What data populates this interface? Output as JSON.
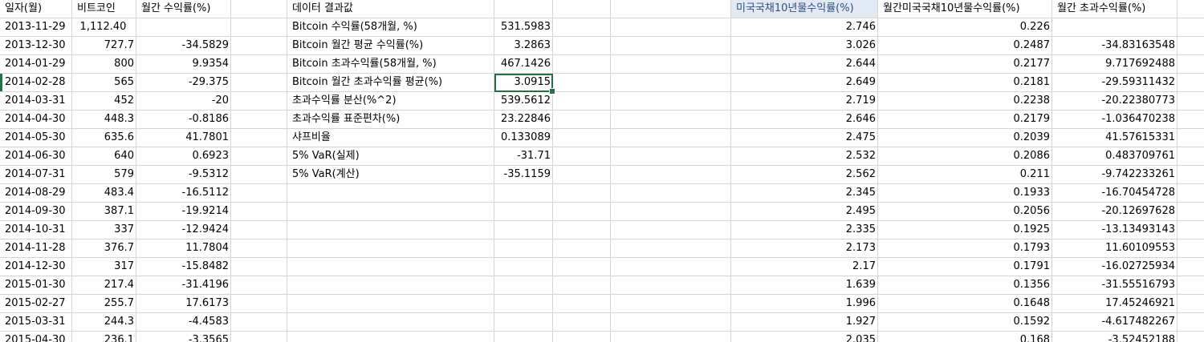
{
  "headers": {
    "date": "일자(월)",
    "btc": "비트코인",
    "btc_ret": "월간 수익률(%)",
    "results": "데이터 결과값",
    "tsy": "미국국채10년물수익률(%)",
    "tsy_month": "월간미국국채10년물수익률(%)",
    "excess": "월간 초과수익률(%)"
  },
  "rows": [
    {
      "date": "2013-11-29",
      "btc": "1,112.40",
      "ret": "",
      "label": "Bitcoin 수익률(58개월, %)",
      "val": "531.5983",
      "tsy": "2.746",
      "tsym": "0.226",
      "ex": ""
    },
    {
      "date": "2013-12-30",
      "btc": "727.7",
      "ret": "-34.5829",
      "label": "Bitcoin 월간 평균 수익률(%)",
      "val": "3.2863",
      "tsy": "3.026",
      "tsym": "0.2487",
      "ex": "-34.83163548"
    },
    {
      "date": "2014-01-29",
      "btc": "800",
      "ret": "9.9354",
      "label": "Bitcoin 초과수익률(58개월, %)",
      "val": "467.1426",
      "tsy": "2.644",
      "tsym": "0.2177",
      "ex": "9.717692488"
    },
    {
      "date": "2014-02-28",
      "btc": "565",
      "ret": "-29.375",
      "label": "Bitcoin 월간 초과수익률 평균(%)",
      "val": "3.0915",
      "tsy": "2.649",
      "tsym": "0.2181",
      "ex": "-29.59311432"
    },
    {
      "date": "2014-03-31",
      "btc": "452",
      "ret": "-20",
      "label": "초과수익률 분산(%^2)",
      "val": "539.5612",
      "tsy": "2.719",
      "tsym": "0.2238",
      "ex": "-20.22380773"
    },
    {
      "date": "2014-04-30",
      "btc": "448.3",
      "ret": "-0.8186",
      "label": "초과수익률 표준편차(%)",
      "val": "23.22846",
      "tsy": "2.646",
      "tsym": "0.2179",
      "ex": "-1.036470238"
    },
    {
      "date": "2014-05-30",
      "btc": "635.6",
      "ret": "41.7801",
      "label": "샤프비율",
      "val": "0.133089",
      "tsy": "2.475",
      "tsym": "0.2039",
      "ex": "41.57615331"
    },
    {
      "date": "2014-06-30",
      "btc": "640",
      "ret": "0.6923",
      "label": "5% VaR(실제)",
      "val": "-31.71",
      "tsy": "2.532",
      "tsym": "0.2086",
      "ex": "0.483709761"
    },
    {
      "date": "2014-07-31",
      "btc": "579",
      "ret": "-9.5312",
      "label": "5% VaR(계산)",
      "val": "-35.1159",
      "tsy": "2.562",
      "tsym": "0.211",
      "ex": "-9.742233261"
    },
    {
      "date": "2014-08-29",
      "btc": "483.4",
      "ret": "-16.5112",
      "label": "",
      "val": "",
      "tsy": "2.345",
      "tsym": "0.1933",
      "ex": "-16.70454728"
    },
    {
      "date": "2014-09-30",
      "btc": "387.1",
      "ret": "-19.9214",
      "label": "",
      "val": "",
      "tsy": "2.495",
      "tsym": "0.2056",
      "ex": "-20.12697628"
    },
    {
      "date": "2014-10-31",
      "btc": "337",
      "ret": "-12.9424",
      "label": "",
      "val": "",
      "tsy": "2.335",
      "tsym": "0.1925",
      "ex": "-13.13493143"
    },
    {
      "date": "2014-11-28",
      "btc": "376.7",
      "ret": "11.7804",
      "label": "",
      "val": "",
      "tsy": "2.173",
      "tsym": "0.1793",
      "ex": "11.60109553"
    },
    {
      "date": "2014-12-30",
      "btc": "317",
      "ret": "-15.8482",
      "label": "",
      "val": "",
      "tsy": "2.17",
      "tsym": "0.1791",
      "ex": "-16.02725934"
    },
    {
      "date": "2015-01-30",
      "btc": "217.4",
      "ret": "-31.4196",
      "label": "",
      "val": "",
      "tsy": "1.639",
      "tsym": "0.1356",
      "ex": "-31.55516793"
    },
    {
      "date": "2015-02-27",
      "btc": "255.7",
      "ret": "17.6173",
      "label": "",
      "val": "",
      "tsy": "1.996",
      "tsym": "0.1648",
      "ex": "17.45246921"
    },
    {
      "date": "2015-03-31",
      "btc": "244.3",
      "ret": "-4.4583",
      "label": "",
      "val": "",
      "tsy": "1.927",
      "tsym": "0.1592",
      "ex": "-4.617482267"
    },
    {
      "date": "2015-04-30",
      "btc": "236.1",
      "ret": "-3.3565",
      "label": "",
      "val": "",
      "tsy": "2.035",
      "tsym": "0.168",
      "ex": "-3.52452188"
    }
  ]
}
